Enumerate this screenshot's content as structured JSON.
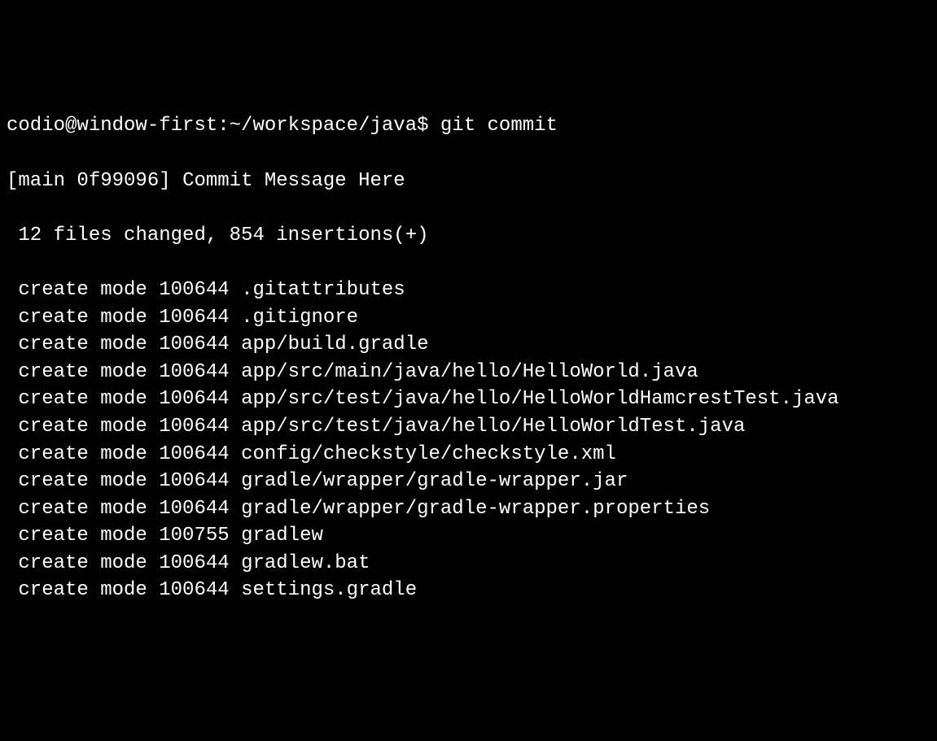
{
  "prompt": {
    "user": "codio",
    "host": "window-first",
    "path": "~/workspace/java",
    "symbol": "$",
    "command": "git commit"
  },
  "commit_header": {
    "branch": "main",
    "hash": "0f99096",
    "message": "Commit Message Here"
  },
  "summary": {
    "files_changed": 12,
    "insertions": 854
  },
  "created_files": [
    {
      "mode": "100644",
      "path": ".gitattributes"
    },
    {
      "mode": "100644",
      "path": ".gitignore"
    },
    {
      "mode": "100644",
      "path": "app/build.gradle"
    },
    {
      "mode": "100644",
      "path": "app/src/main/java/hello/HelloWorld.java"
    },
    {
      "mode": "100644",
      "path": "app/src/test/java/hello/HelloWorldHamcrestTest.java"
    },
    {
      "mode": "100644",
      "path": "app/src/test/java/hello/HelloWorldTest.java"
    },
    {
      "mode": "100644",
      "path": "config/checkstyle/checkstyle.xml"
    },
    {
      "mode": "100644",
      "path": "gradle/wrapper/gradle-wrapper.jar"
    },
    {
      "mode": "100644",
      "path": "gradle/wrapper/gradle-wrapper.properties"
    },
    {
      "mode": "100755",
      "path": "gradlew"
    },
    {
      "mode": "100644",
      "path": "gradlew.bat"
    },
    {
      "mode": "100644",
      "path": "settings.gradle"
    }
  ]
}
